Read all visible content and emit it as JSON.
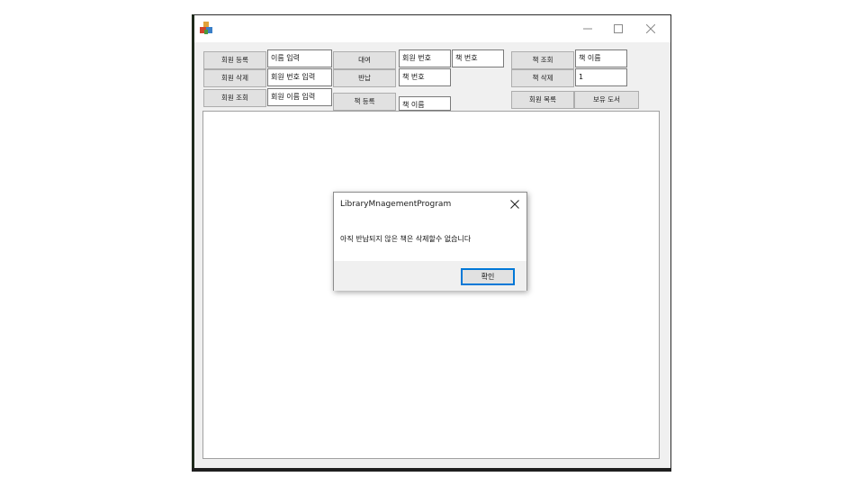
{
  "window": {
    "caption_buttons": {
      "minimize_icon": "minimize-icon",
      "maximize_icon": "maximize-icon",
      "close_icon": "close-icon"
    }
  },
  "toolbar": {
    "member_register_label": "회원 등록",
    "member_delete_label": "회원 삭제",
    "member_search_label": "회원 조회",
    "member_name_input_value": "이름 입력",
    "member_number_input_value": "회원 번호 입력",
    "member_name_search_value": "회원 이름 입력",
    "rent_label": "대여",
    "return_label": "반납",
    "book_register_label": "책 등록",
    "rent_member_number_value": "회원 번호",
    "rent_book_number_value": "책 번호",
    "return_book_number_value": "책 번호",
    "register_book_name_value": "책 이름",
    "book_search_label": "책 조회",
    "book_delete_label": "책 삭제",
    "member_list_label": "회원 목록",
    "owned_books_label": "보유 도서",
    "book_search_name_value": "책 이름",
    "book_delete_id_value": "1"
  },
  "dialog": {
    "title": "LibraryMnagementProgram",
    "message": "아직 반납되지 않은 책은 삭제할수 없습니다",
    "ok_label": "확인"
  },
  "colors": {
    "accent": "#0078d7",
    "button_face": "#e1e1e1",
    "window_face": "#f0f0f0"
  }
}
